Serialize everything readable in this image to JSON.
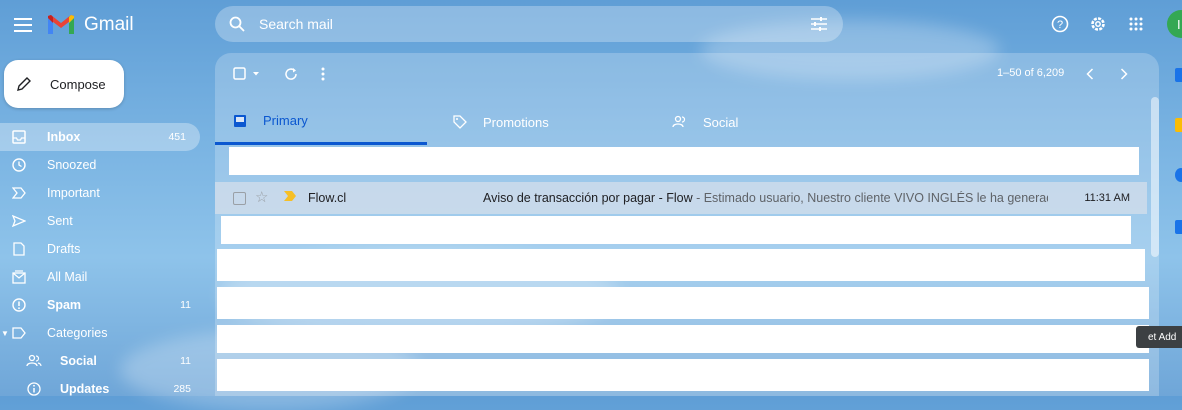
{
  "app": {
    "name": "Gmail"
  },
  "search": {
    "placeholder": "Search mail"
  },
  "compose": {
    "label": "Compose"
  },
  "avatar_letter": "I",
  "sidebar": {
    "items": [
      {
        "label": "Inbox",
        "count": "451",
        "icon": "inbox-icon",
        "active": true
      },
      {
        "label": "Snoozed",
        "count": "",
        "icon": "clock-icon"
      },
      {
        "label": "Important",
        "count": "",
        "icon": "important-icon"
      },
      {
        "label": "Sent",
        "count": "",
        "icon": "send-icon"
      },
      {
        "label": "Drafts",
        "count": "",
        "icon": "draft-icon"
      },
      {
        "label": "All Mail",
        "count": "",
        "icon": "all-mail-icon"
      },
      {
        "label": "Spam",
        "count": "11",
        "icon": "spam-icon"
      },
      {
        "label": "Categories",
        "count": "",
        "icon": "label-icon"
      },
      {
        "label": "Social",
        "count": "11",
        "icon": "people-icon"
      },
      {
        "label": "Updates",
        "count": "285",
        "icon": "info-icon"
      }
    ]
  },
  "toolbar": {
    "pagination": "1–50 of 6,209"
  },
  "tabs": [
    {
      "label": "Primary",
      "icon": "inbox-icon",
      "active": true
    },
    {
      "label": "Promotions",
      "icon": "tag-icon"
    },
    {
      "label": "Social",
      "icon": "people-icon"
    }
  ],
  "emails": [
    {
      "sender": "Flow.cl",
      "subject": "Aviso de transacción por pagar - Flow",
      "snippet": " - Estimado usuario, Nuestro cliente VIVO INGLÉS le ha generad...",
      "time": "11:31 AM"
    }
  ],
  "tooltip": {
    "text": "et Add"
  },
  "colors": {
    "accent": "#0b57d0",
    "important": "#f6bf26"
  }
}
